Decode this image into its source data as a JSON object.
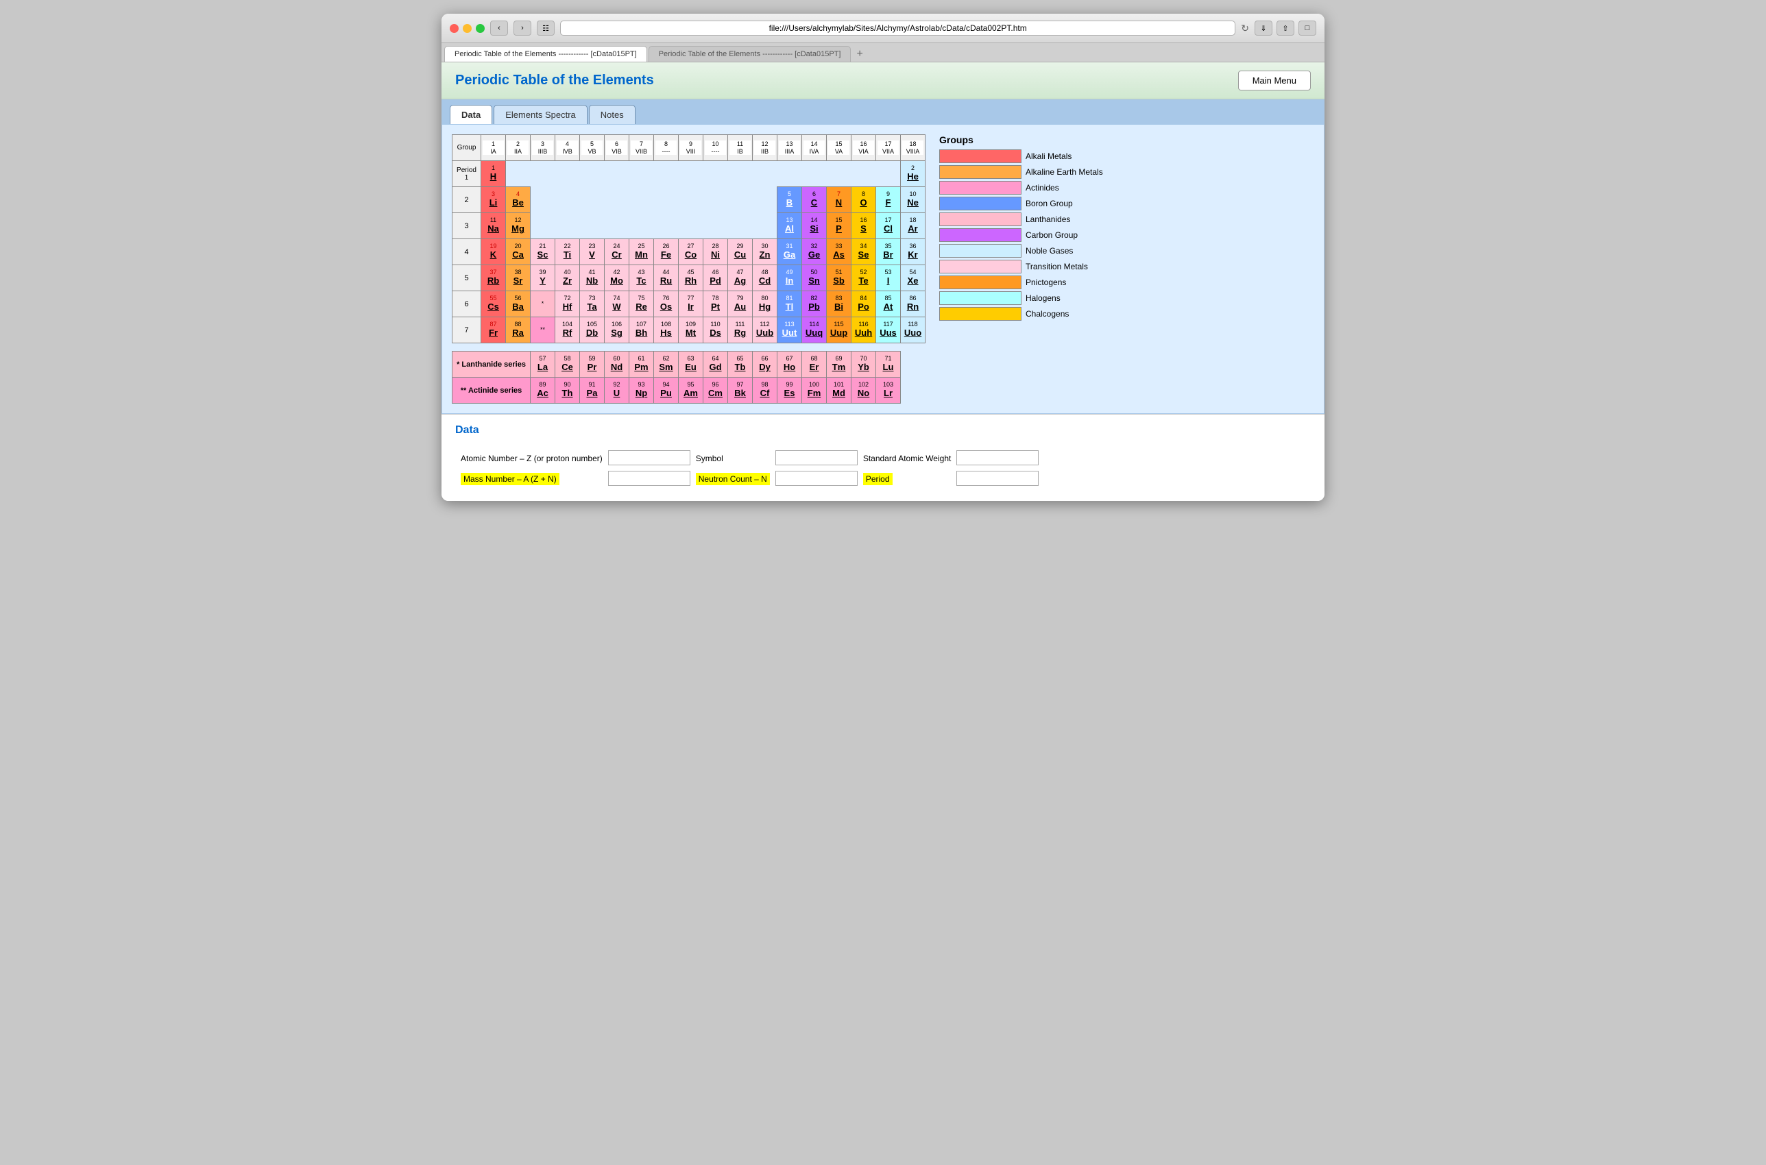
{
  "browser": {
    "url": "file:///Users/alchymylab/Sites/Alchymy/Astrolab/cData/cData002PT.htm",
    "tab1": "Periodic Table of the Elements ------------ [cData015PT]",
    "tab2": "Periodic Table of the Elements ------------ [cData015PT]"
  },
  "page": {
    "title": "Periodic Table of the Elements",
    "main_menu": "Main Menu"
  },
  "tabs": {
    "data": "Data",
    "elements_spectra": "Elements Spectra",
    "notes": "Notes"
  },
  "legend": {
    "title": "Groups",
    "items": [
      {
        "label": "Alkali Metals",
        "color": "#ff6666"
      },
      {
        "label": "Alkaline Earth Metals",
        "color": "#ffaa44"
      },
      {
        "label": "Actinides",
        "color": "#ff99cc"
      },
      {
        "label": "Boron Group",
        "color": "#6699ff"
      },
      {
        "label": "Lanthanides",
        "color": "#ffbbcc"
      },
      {
        "label": "Carbon Group",
        "color": "#cc66ff"
      },
      {
        "label": "Noble Gases",
        "color": "#cceeff"
      },
      {
        "label": "Transition Metals",
        "color": "#ffccdd"
      },
      {
        "label": "Pnictogens",
        "color": "#ff9922"
      },
      {
        "label": "Halogens",
        "color": "#aaffff"
      },
      {
        "label": "Chalcogens",
        "color": "#ffcc00"
      }
    ]
  },
  "data_section": {
    "title": "Data",
    "fields": [
      {
        "label": "Atomic Number – Z (or proton number)",
        "highlight": false,
        "placeholder": ""
      },
      {
        "label": "Symbol",
        "highlight": false,
        "placeholder": ""
      },
      {
        "label": "Standard Atomic Weight",
        "highlight": false,
        "placeholder": ""
      },
      {
        "label": "Mass Number – A (Z + N)",
        "highlight": true,
        "placeholder": ""
      },
      {
        "label": "Neutron Count – N",
        "highlight": true,
        "placeholder": ""
      },
      {
        "label": "Period",
        "highlight": true,
        "placeholder": ""
      }
    ]
  }
}
